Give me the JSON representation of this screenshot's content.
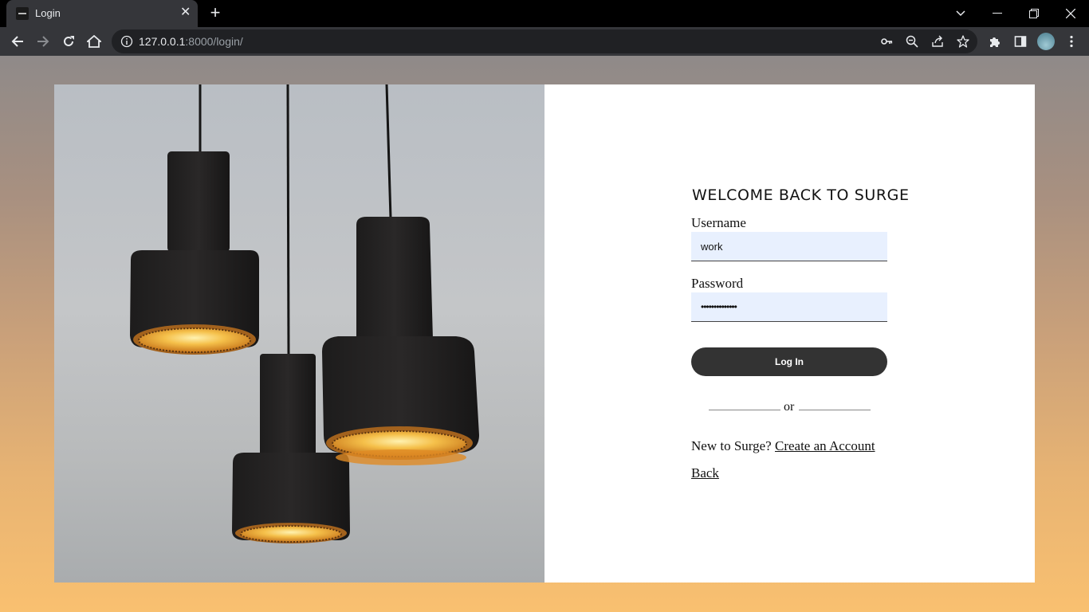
{
  "browser": {
    "tab_title": "Login",
    "url_host": "127.0.0.1",
    "url_rest": ":8000/login/"
  },
  "login": {
    "heading": "WELCOME BACK TO SURGE",
    "username_label": "Username",
    "username_value": "work",
    "password_label": "Password",
    "password_value": "••••••••••••••",
    "login_button": "Log In",
    "divider_text": "or",
    "signup_prompt": "New to Surge?",
    "signup_link": "Create an Account",
    "back_link": "Back"
  },
  "colors": {
    "input_bg": "#e8f0fe",
    "button_bg": "#333333",
    "lamp_glow": "#f4a52a"
  }
}
